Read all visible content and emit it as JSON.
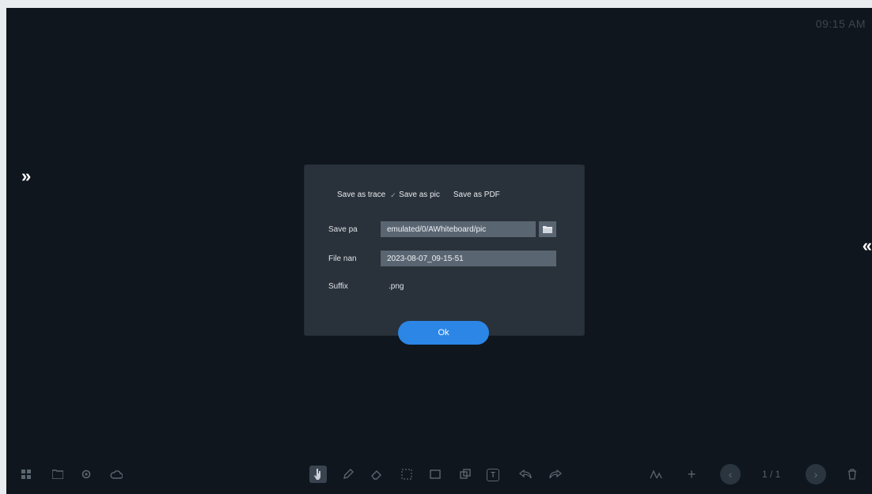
{
  "clock": "09:15 AM",
  "nav": {
    "left_glyph": "»",
    "right_glyph": "«"
  },
  "dialog": {
    "options": [
      {
        "label": "Save as trace",
        "checked": false
      },
      {
        "label": "Save as pic",
        "checked": true
      },
      {
        "label": "Save as PDF",
        "checked": false
      }
    ],
    "save_path_label": "Save pa",
    "save_path_value": "emulated/0/AWhiteboard/pic",
    "file_name_label": "File nan",
    "file_name_value": "2023-08-07_09-15-51",
    "suffix_label": "Suffix",
    "suffix_value": ".png",
    "ok_label": "Ok"
  },
  "toolbar": {
    "page_indicator": "1 / 1"
  },
  "colors": {
    "accent": "#2b86e6",
    "dialog_bg": "#29313a",
    "field_bg": "#5a6572",
    "board_bg": "#0f161d"
  }
}
